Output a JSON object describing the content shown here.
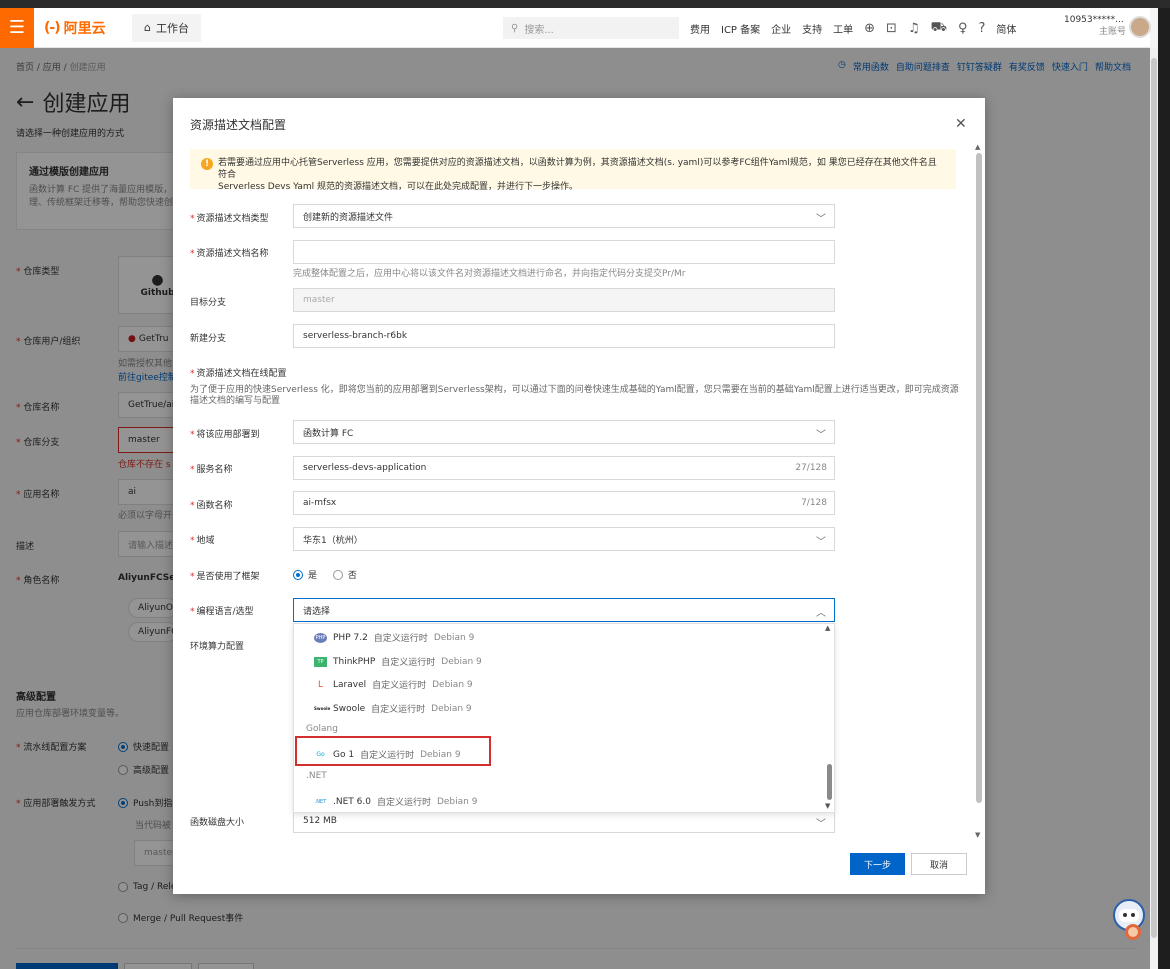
{
  "header": {
    "logo_text": "阿里云",
    "workbench": "工作台",
    "search_placeholder": "搜索...",
    "links": [
      "费用",
      "ICP 备案",
      "企业",
      "支持",
      "工单"
    ],
    "lang": "简体",
    "account_id": "10953*****...",
    "account_sub": "主账号"
  },
  "page": {
    "breadcrumb": [
      "首页",
      "应用",
      "创建应用"
    ],
    "help_links": [
      "常用函数",
      "自助问题排查",
      "钉钉答疑群",
      "有奖反馈",
      "快速入门",
      "帮助文档"
    ],
    "title": "创建应用",
    "subtitle": "请选择一种创建应用的方式",
    "template_card": {
      "title": "通过模版创建应用",
      "desc1": "函数计算 FC 提供了海量应用模版，包",
      "desc2": "理、传统框架迁移等，帮助您快速创建"
    },
    "labels": {
      "repo_type": "仓库类型",
      "repo_user": "仓库用户/组织",
      "repo_name": "仓库名称",
      "repo_branch": "仓库分支",
      "app_name": "应用名称",
      "desc": "描述",
      "role_name": "角色名称",
      "pipeline": "流水线配置方案",
      "trigger": "应用部署触发方式"
    },
    "values": {
      "github": "Github",
      "gettrue": "GetTru",
      "auth_hint": "如需授权其他",
      "gitee_link": "前往gitee控制",
      "repo_name": "GetTrue/ai",
      "branch": "master",
      "branch_err": "仓库不存在 s",
      "app_name": "ai",
      "app_name_hint": "必须以字母开",
      "desc_placeholder": "请输入描述",
      "role": "AliyunFCServ",
      "role_tag1": "AliyunOSS",
      "role_tag2": "AliyunFCS",
      "pipeline_fast": "快速配置",
      "pipeline_adv": "高级配置",
      "push": "Push到指",
      "push_hint": "当代码被",
      "master_ph": "master",
      "tag": "Tag / Rele",
      "merge": "Merge / Pull Request事件"
    },
    "advanced_title": "高级配置",
    "advanced_sub": "应用仓库部署环境变量等。"
  },
  "modal": {
    "title": "资源描述文档配置",
    "notice_line1": "若需要通过应用中心托管Serverless 应用，您需要提供对应的资源描述文档，以函数计算为例，其资源描述文档(s. yaml)可以参考FC组件Yaml规范，如 果您已经存在其他文件名且符合",
    "notice_line2": "Serverless Devs Yaml 规范的资源描述文档，可以在此处完成配置，并进行下一步操作。",
    "fields": {
      "doc_type_label": "资源描述文档类型",
      "doc_type_value": "创建新的资源描述文件",
      "doc_name_label": "资源描述文档名称",
      "doc_name_help": "完成整体配置之后，应用中心将以该文件名对资源描述文档进行命名，并向指定代码分支提交Pr/Mr",
      "target_branch_label": "目标分支",
      "target_branch_value": "master",
      "new_branch_label": "新建分支",
      "new_branch_value": "serverless-branch-r6bk",
      "online_label": "资源描述文档在线配置",
      "online_desc": "为了便于应用的快速Serverless 化，即将您当前的应用部署到Serverless架构，可以通过下面的问卷快速生成基础的Yaml配置，您只需要在当前的基础Yaml配置上进行适当更改，即可完成资源描述文档的编写与配置",
      "deploy_label": "将该应用部署到",
      "deploy_value": "函数计算 FC",
      "service_label": "服务名称",
      "service_value": "serverless-devs-application",
      "service_count": "27/128",
      "function_label": "函数名称",
      "function_value": "ai-mfsx",
      "function_count": "7/128",
      "region_label": "地域",
      "region_value": "华东1（杭州）",
      "framework_label": "是否使用了框架",
      "framework_yes": "是",
      "framework_no": "否",
      "lang_label": "编程语言/选型",
      "lang_placeholder": "请选择",
      "env_label": "环境算力配置",
      "disk_label": "函数磁盘大小",
      "disk_value": "512 MB"
    },
    "dropdown": {
      "custom_runtime": "自定义运行时",
      "os": "Debian 9",
      "items": [
        {
          "icon": "PHP",
          "name": "PHP 7.2"
        },
        {
          "icon": "TP",
          "name": "ThinkPHP"
        },
        {
          "icon": "L",
          "name": "Laravel"
        },
        {
          "icon": "Swoole",
          "name": "Swoole"
        }
      ],
      "group_golang": "Golang",
      "go_item": {
        "icon": "Go",
        "name": "Go 1"
      },
      "group_net": ".NET",
      "net_item": {
        "icon": ".NET",
        "name": ".NET 6.0"
      }
    },
    "next_button": "下一步",
    "cancel_button": "取消"
  },
  "colors": {
    "accent": "#ff6a00",
    "primary": "#0064c8",
    "highlight_box": "#d32f2f"
  }
}
